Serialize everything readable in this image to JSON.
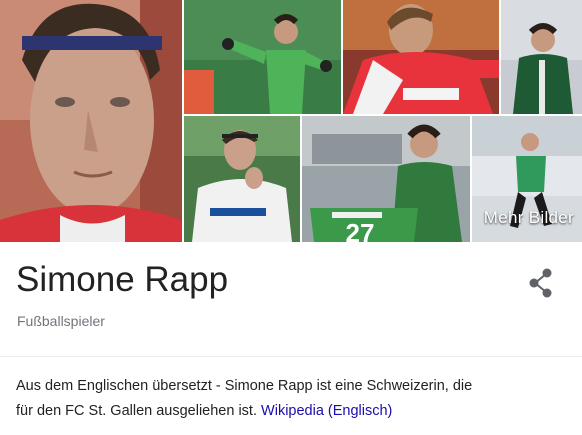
{
  "gallery": {
    "more_images_label": "Mehr Bilder",
    "jersey_text": "27"
  },
  "entity": {
    "name": "Simone Rapp",
    "type": "Fußballspieler"
  },
  "share": {
    "icon": "share-icon"
  },
  "description": {
    "line1": "Aus dem Englischen übersetzt - Simone Rapp ist eine Schweizerin, die",
    "line2": "für den FC St. Gallen ausgeliehen ist.",
    "source_link": "Wikipedia (Englisch)"
  },
  "colors": {
    "title": "#222222",
    "subtitle": "#70757a",
    "link": "#1a0dab",
    "divider": "#ebebeb"
  }
}
